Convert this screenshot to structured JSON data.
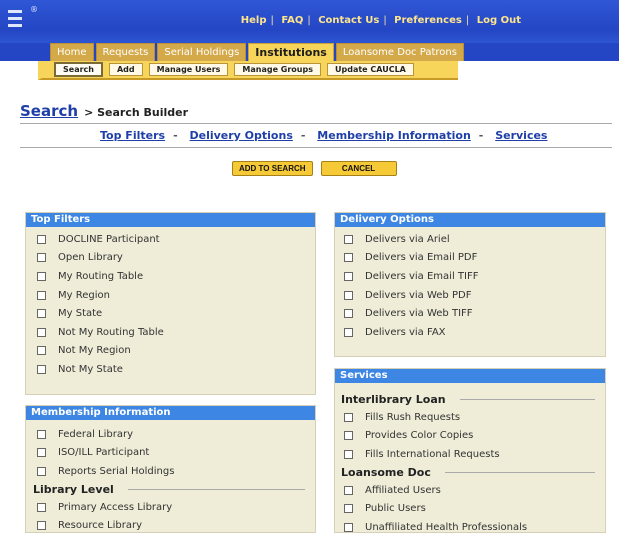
{
  "top_links": [
    "Help",
    "FAQ",
    "Contact Us",
    "Preferences",
    "Log Out"
  ],
  "tabs": [
    {
      "label": "Home",
      "active": false
    },
    {
      "label": "Requests",
      "active": false
    },
    {
      "label": "Serial Holdings",
      "active": false
    },
    {
      "label": "Institutions",
      "active": true
    },
    {
      "label": "Loansome Doc Patrons",
      "active": false
    }
  ],
  "subtabs": [
    "Search",
    "Add",
    "Manage Users",
    "Manage Groups",
    "Update CAUCLA"
  ],
  "page": {
    "search_link": "Search",
    "crumb": "> Search Builder",
    "anchors": [
      "Top Filters",
      "Delivery Options",
      "Membership Information",
      "Services"
    ],
    "add_button": "ADD TO SEARCH",
    "cancel_button": "CANCEL"
  },
  "panels": {
    "top_filters": {
      "title": "Top Filters",
      "items": [
        "DOCLINE Participant",
        "Open Library",
        "My Routing Table",
        "My Region",
        "My State",
        "Not My Routing Table",
        "Not My Region",
        "Not My State"
      ]
    },
    "delivery_options": {
      "title": "Delivery Options",
      "items": [
        "Delivers via Ariel",
        "Delivers via Email PDF",
        "Delivers via Email TIFF",
        "Delivers via Web PDF",
        "Delivers via Web TIFF",
        "Delivers via FAX"
      ]
    },
    "membership": {
      "title": "Membership Information",
      "items": [
        "Federal Library",
        "ISO/ILL Participant",
        "Reports Serial Holdings"
      ],
      "group": "Library Level",
      "group_items": [
        "Primary Access Library",
        "Resource Library"
      ]
    },
    "services": {
      "title": "Services",
      "group1": "Interlibrary Loan",
      "group1_items": [
        "Fills Rush Requests",
        "Provides Color Copies",
        "Fills International Requests"
      ],
      "group2": "Loansome Doc",
      "group2_items": [
        "Affiliated Users",
        "Public Users",
        "Unaffiliated Health Professionals"
      ]
    }
  },
  "colors": {
    "top_bar": "#2446c4",
    "active_tab": "#f6d55a",
    "panel_header": "#3d86e4",
    "panel_bg": "#efecd8",
    "link": "#1f3fa8"
  }
}
